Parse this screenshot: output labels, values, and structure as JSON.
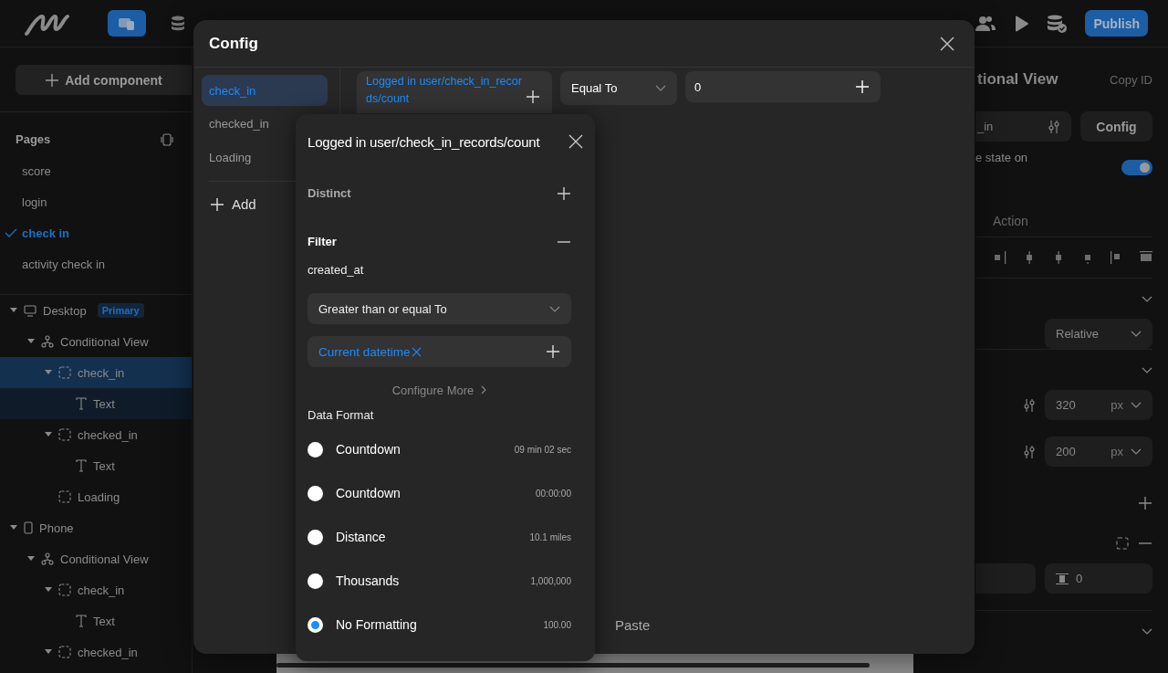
{
  "topbar": {
    "tools": [
      {
        "selected": true
      },
      {
        "selected": false
      }
    ],
    "publish": "Publish"
  },
  "sidebar": {
    "add_component": "Add component",
    "pages_title": "Pages",
    "pages": [
      {
        "label": "score",
        "selected": false
      },
      {
        "label": "login",
        "selected": false
      },
      {
        "label": "check in",
        "selected": true
      },
      {
        "label": "activity check in",
        "selected": false
      }
    ],
    "tree": [
      {
        "label": "Desktop",
        "kind": "desktop",
        "badge": "Primary",
        "expanded": true,
        "selected": false,
        "children": [
          {
            "label": "Conditional View",
            "kind": "conditional",
            "expanded": true,
            "selected": false,
            "children": [
              {
                "label": "check_in",
                "kind": "container",
                "expanded": true,
                "selected": true,
                "children": [
                  {
                    "label": "Text",
                    "kind": "text",
                    "expanded": false,
                    "selected": false
                  }
                ]
              },
              {
                "label": "checked_in",
                "kind": "container",
                "expanded": true,
                "selected": false,
                "children": [
                  {
                    "label": "Text",
                    "kind": "text",
                    "expanded": false,
                    "selected": false
                  }
                ]
              },
              {
                "label": "Loading",
                "kind": "container",
                "expanded": false,
                "selected": false
              }
            ]
          }
        ]
      },
      {
        "label": "Phone",
        "kind": "phone",
        "expanded": true,
        "selected": false,
        "children": [
          {
            "label": "Conditional View",
            "kind": "conditional",
            "expanded": true,
            "selected": false,
            "children": [
              {
                "label": "check_in",
                "kind": "container",
                "expanded": true,
                "selected": false,
                "children": [
                  {
                    "label": "Text",
                    "kind": "text",
                    "expanded": false,
                    "selected": false
                  }
                ]
              },
              {
                "label": "checked_in",
                "kind": "container",
                "expanded": true,
                "selected": false
              }
            ]
          }
        ]
      }
    ]
  },
  "right_panel": {
    "title": "tional View",
    "copy_id": "Copy ID",
    "field_value": "_in",
    "config": "Config",
    "toggle_label": "e state on",
    "toggle_on": true,
    "tab": "Action",
    "position": "Relative",
    "width": {
      "value": "320",
      "unit": "px"
    },
    "height": {
      "value": "200",
      "unit": "px"
    },
    "spacing_value": "0"
  },
  "modal": {
    "title": "Config",
    "conditions": [
      {
        "label": "check_in",
        "selected": true
      },
      {
        "label": "checked_in",
        "selected": false
      },
      {
        "label": "Loading",
        "selected": false
      }
    ],
    "add": "Add",
    "left_operand": "Logged in user/check_in_records/count",
    "operator": "Equal To",
    "right_operand": "0",
    "paste": "Paste"
  },
  "popover": {
    "title": "Logged in user/check_in_records/count",
    "distinct": {
      "label": "Distinct",
      "expanded": false
    },
    "filter": {
      "label": "Filter",
      "expanded": true,
      "field": "created_at",
      "operator": "Greater than or equal To",
      "value": "Current datetime"
    },
    "configure_more": "Configure More",
    "data_format_label": "Data Format",
    "formats": [
      {
        "label": "Countdown",
        "sample": "09 min 02 sec",
        "selected": false
      },
      {
        "label": "Countdown",
        "sample": "00:00:00",
        "selected": false
      },
      {
        "label": "Distance",
        "sample": "10.1 miles",
        "selected": false
      },
      {
        "label": "Thousands",
        "sample": "1,000,000",
        "selected": false
      },
      {
        "label": "No Formatting",
        "sample": "100.00",
        "selected": true
      }
    ]
  }
}
